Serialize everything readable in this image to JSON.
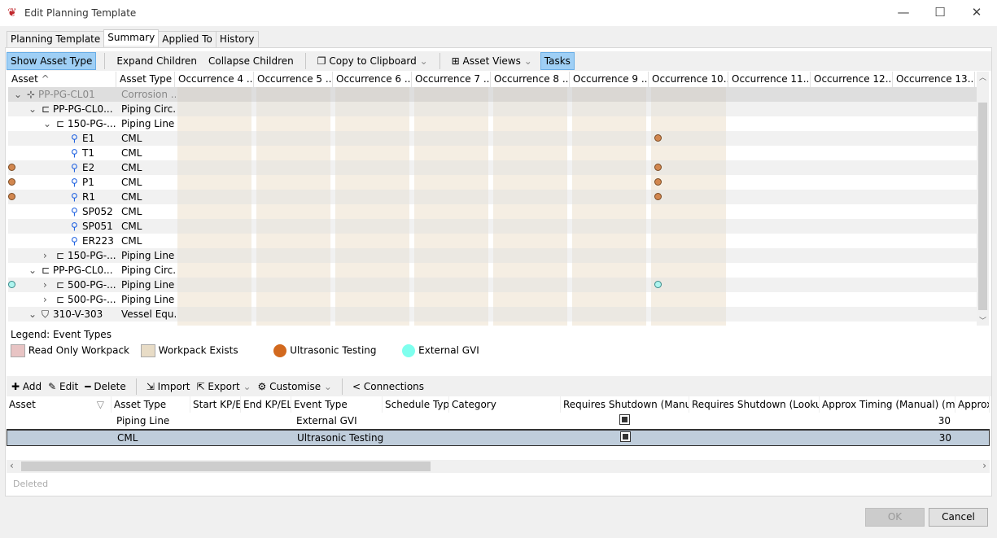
{
  "window": {
    "title": "Edit Planning Template",
    "minimize": "—",
    "maximize": "☐",
    "close": "✕"
  },
  "tabs": [
    "Planning Template",
    "Summary",
    "Applied To",
    "History"
  ],
  "active_tab": 1,
  "toolbar": {
    "show_asset_type": "Show Asset Type",
    "expand": "Expand Children",
    "collapse": "Collapse Children",
    "copy": "Copy to Clipboard",
    "asset_views": "Asset Views",
    "tasks": "Tasks"
  },
  "grid": {
    "columns": [
      "Asset",
      "Asset Type",
      "Occurrence 4 ...",
      "Occurrence 5 ...",
      "Occurrence 6 ...",
      "Occurrence 7 ...",
      "Occurrence 8 ...",
      "Occurrence 9 ...",
      "Occurrence 10...",
      "Occurrence 11...",
      "Occurrence 12...",
      "Occurrence 13..."
    ],
    "rows": [
      {
        "indent": 0,
        "exp": "v",
        "icon": "circuit",
        "name": "PP-PG-CL01",
        "type": "Corrosion ...",
        "sel": true
      },
      {
        "indent": 1,
        "exp": "v",
        "icon": "pipe",
        "name": "PP-PG-CL0...",
        "type": "Piping Circ..."
      },
      {
        "indent": 2,
        "exp": "v",
        "icon": "pipe",
        "name": "150-PG-...",
        "type": "Piping Line"
      },
      {
        "indent": 3,
        "icon": "cml",
        "name": "E1",
        "type": "CML",
        "dots": [
          [
            6,
            "ut"
          ],
          [
            10,
            "ut"
          ]
        ]
      },
      {
        "indent": 3,
        "icon": "cml",
        "name": "T1",
        "type": "CML"
      },
      {
        "indent": 3,
        "icon": "cml",
        "name": "E2",
        "type": "CML",
        "dots": [
          [
            6,
            "ut"
          ],
          [
            11,
            "ut"
          ]
        ]
      },
      {
        "indent": 3,
        "icon": "cml",
        "name": "P1",
        "type": "CML",
        "dots": [
          [
            6,
            "ut"
          ],
          [
            11,
            "ut"
          ]
        ]
      },
      {
        "indent": 3,
        "icon": "cml",
        "name": "R1",
        "type": "CML",
        "dots": [
          [
            6,
            "ut"
          ],
          [
            11,
            "ut"
          ]
        ]
      },
      {
        "indent": 3,
        "icon": "cml",
        "name": "SP052",
        "type": "CML"
      },
      {
        "indent": 3,
        "icon": "cml",
        "name": "SP051",
        "type": "CML"
      },
      {
        "indent": 3,
        "icon": "cml",
        "name": "ER223",
        "type": "CML"
      },
      {
        "indent": 2,
        "exp": ">",
        "icon": "pipe",
        "name": "150-PG-...",
        "type": "Piping Line"
      },
      {
        "indent": 1,
        "exp": "v",
        "icon": "pipe",
        "name": "PP-PG-CL0...",
        "type": "Piping Circ..."
      },
      {
        "indent": 2,
        "exp": ">",
        "icon": "pipe",
        "name": "500-PG-...",
        "type": "Piping Line",
        "dots": [
          [
            6,
            "gvi"
          ],
          [
            11,
            "gvi"
          ]
        ]
      },
      {
        "indent": 2,
        "exp": ">",
        "icon": "pipe",
        "name": "500-PG-...",
        "type": "Piping Line"
      },
      {
        "indent": 1,
        "exp": "v",
        "icon": "vessel",
        "name": "310-V-303",
        "type": "Vessel Equ..."
      }
    ]
  },
  "legend": {
    "title": "Legend: Event Types",
    "items": [
      {
        "label": "Read Only Workpack",
        "color": "#e8c4c4",
        "shape": "square"
      },
      {
        "label": "Workpack Exists",
        "color": "#e8dcc6",
        "shape": "square"
      },
      {
        "label": "Ultrasonic Testing",
        "color": "#d2691e",
        "shape": "circle"
      },
      {
        "label": "External GVI",
        "color": "#7fffee",
        "shape": "circle"
      }
    ]
  },
  "colors": {
    "ut": "#d2874f",
    "gvi": "#aef5ef",
    "shade": "#f5eee3"
  },
  "bottom_toolbar": {
    "add": "Add",
    "edit": "Edit",
    "delete": "Delete",
    "import": "Import",
    "export": "Export",
    "customise": "Customise",
    "connections": "Connections"
  },
  "tasks": {
    "columns": [
      "Asset",
      "Asset Type",
      "Start KP/EL",
      "End KP/EL",
      "Event Type",
      "Schedule Type",
      "Category",
      "Requires Shutdown (Manual)",
      "Requires Shutdown (Lookup)",
      "Approx Timing (Manual) (min)",
      "Approx"
    ],
    "rows": [
      {
        "asset": "",
        "asset_type": "Piping Line",
        "event_type": "External GVI",
        "shutdown_manual": true,
        "timing": "30"
      },
      {
        "asset": "",
        "asset_type": "CML",
        "event_type": "Ultrasonic Testing",
        "shutdown_manual": true,
        "timing": "30",
        "selected": true
      }
    ]
  },
  "status": "Deleted",
  "buttons": {
    "ok": "OK",
    "cancel": "Cancel"
  }
}
